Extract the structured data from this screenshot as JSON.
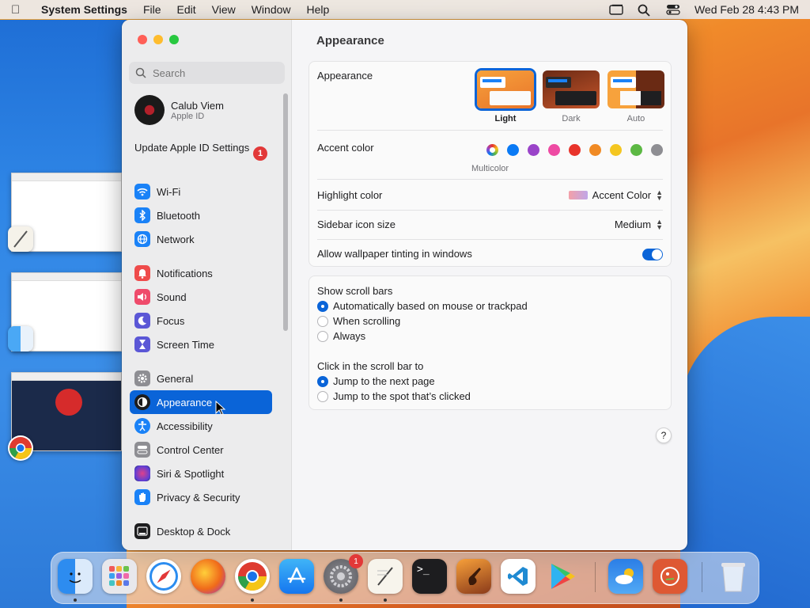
{
  "menubar": {
    "app": "System Settings",
    "menus": [
      "File",
      "Edit",
      "View",
      "Window",
      "Help"
    ],
    "datetime": "Wed Feb 28  4:43 PM"
  },
  "sidebar": {
    "search_placeholder": "Search",
    "profile": {
      "name": "Calub Viem",
      "subtitle": "Apple ID"
    },
    "update": {
      "label": "Update Apple ID Settings",
      "badge": "1"
    },
    "items": [
      {
        "label": "Wi-Fi",
        "icon": "wifi-icon",
        "color": "#1a82f7"
      },
      {
        "label": "Bluetooth",
        "icon": "bluetooth-icon",
        "color": "#1a82f7"
      },
      {
        "label": "Network",
        "icon": "globe-icon",
        "color": "#1a82f7"
      },
      {
        "label": "Notifications",
        "icon": "bell-icon",
        "color": "#ef4b4b"
      },
      {
        "label": "Sound",
        "icon": "speaker-icon",
        "color": "#ef4b6b"
      },
      {
        "label": "Focus",
        "icon": "moon-icon",
        "color": "#5b57d6"
      },
      {
        "label": "Screen Time",
        "icon": "hourglass-icon",
        "color": "#5b57d6"
      },
      {
        "label": "General",
        "icon": "gear-icon",
        "color": "#8e8e93"
      },
      {
        "label": "Appearance",
        "icon": "appearance-icon",
        "color": "#1d1d1f",
        "active": true
      },
      {
        "label": "Accessibility",
        "icon": "accessibility-icon",
        "color": "#1a82f7"
      },
      {
        "label": "Control Center",
        "icon": "toggles-icon",
        "color": "#8e8e93"
      },
      {
        "label": "Siri & Spotlight",
        "icon": "siri-icon",
        "color": "#7b3fd6"
      },
      {
        "label": "Privacy & Security",
        "icon": "hand-icon",
        "color": "#1a82f7"
      },
      {
        "label": "Desktop & Dock",
        "icon": "dock-icon",
        "color": "#1d1d1f"
      }
    ]
  },
  "content": {
    "title": "Appearance",
    "appearance": {
      "label": "Appearance",
      "options": [
        {
          "label": "Light",
          "selected": true
        },
        {
          "label": "Dark",
          "selected": false
        },
        {
          "label": "Auto",
          "selected": false
        }
      ]
    },
    "accent": {
      "label": "Accent color",
      "caption": "Multicolor",
      "colors": [
        "#0a7af5",
        "#9a44c9",
        "#ee4aa3",
        "#e8332b",
        "#f08a24",
        "#f4c620",
        "#5cb843",
        "#8e8e93"
      ]
    },
    "highlight": {
      "label": "Highlight color",
      "value": "Accent Color"
    },
    "sidebar_icon_size": {
      "label": "Sidebar icon size",
      "value": "Medium"
    },
    "wallpaper_tinting": {
      "label": "Allow wallpaper tinting in windows",
      "on": true
    },
    "scroll_bars": {
      "label": "Show scroll bars",
      "options": [
        "Automatically based on mouse or trackpad",
        "When scrolling",
        "Always"
      ],
      "selected": 0
    },
    "click_scroll": {
      "label": "Click in the scroll bar to",
      "options": [
        "Jump to the next page",
        "Jump to the spot that’s clicked"
      ],
      "selected": 0
    },
    "help": "?"
  },
  "dock": {
    "apps": [
      "Finder",
      "Launchpad",
      "Safari",
      "Firefox",
      "Chrome",
      "App Store",
      "System Settings",
      "TextEdit",
      "Terminal",
      "GarageBand",
      "VS Code",
      "Play Store",
      "Weather",
      "DuckDuckGo",
      "Trash"
    ],
    "settings_badge": "1"
  }
}
